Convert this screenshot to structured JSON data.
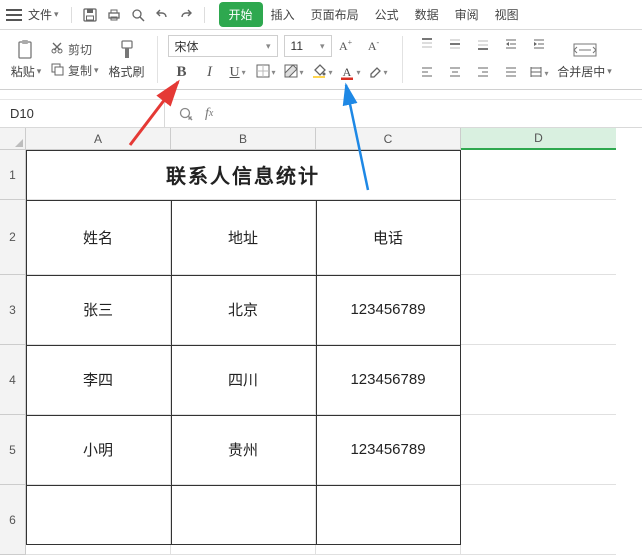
{
  "menu": {
    "file_label": "文件"
  },
  "tabs": {
    "start": "开始",
    "insert": "插入",
    "page_layout": "页面布局",
    "formula": "公式",
    "data": "数据",
    "review": "审阅",
    "view": "视图"
  },
  "ribbon": {
    "clipboard": {
      "paste": "粘贴",
      "cut": "剪切",
      "copy": "复制",
      "format_painter": "格式刷"
    },
    "font": {
      "name": "宋体",
      "size": "11"
    },
    "merge_center": "合并居中"
  },
  "namebox": {
    "ref": "D10"
  },
  "columns": {
    "a": "A",
    "b": "B",
    "c": "C",
    "d": "D"
  },
  "rows": {
    "r1": "1",
    "r2": "2",
    "r3": "3",
    "r4": "4",
    "r5": "5",
    "r6": "6"
  },
  "sheet": {
    "title": "联系人信息统计",
    "headers": {
      "name": "姓名",
      "addr": "地址",
      "phone": "电话"
    },
    "rows": [
      {
        "name": "张三",
        "addr": "北京",
        "phone": "123456789"
      },
      {
        "name": "李四",
        "addr": "四川",
        "phone": "123456789"
      },
      {
        "name": "小明",
        "addr": "贵州",
        "phone": "123456789"
      }
    ]
  },
  "annot": {
    "red_target": "bold-button",
    "blue_target": "font-color-button"
  }
}
